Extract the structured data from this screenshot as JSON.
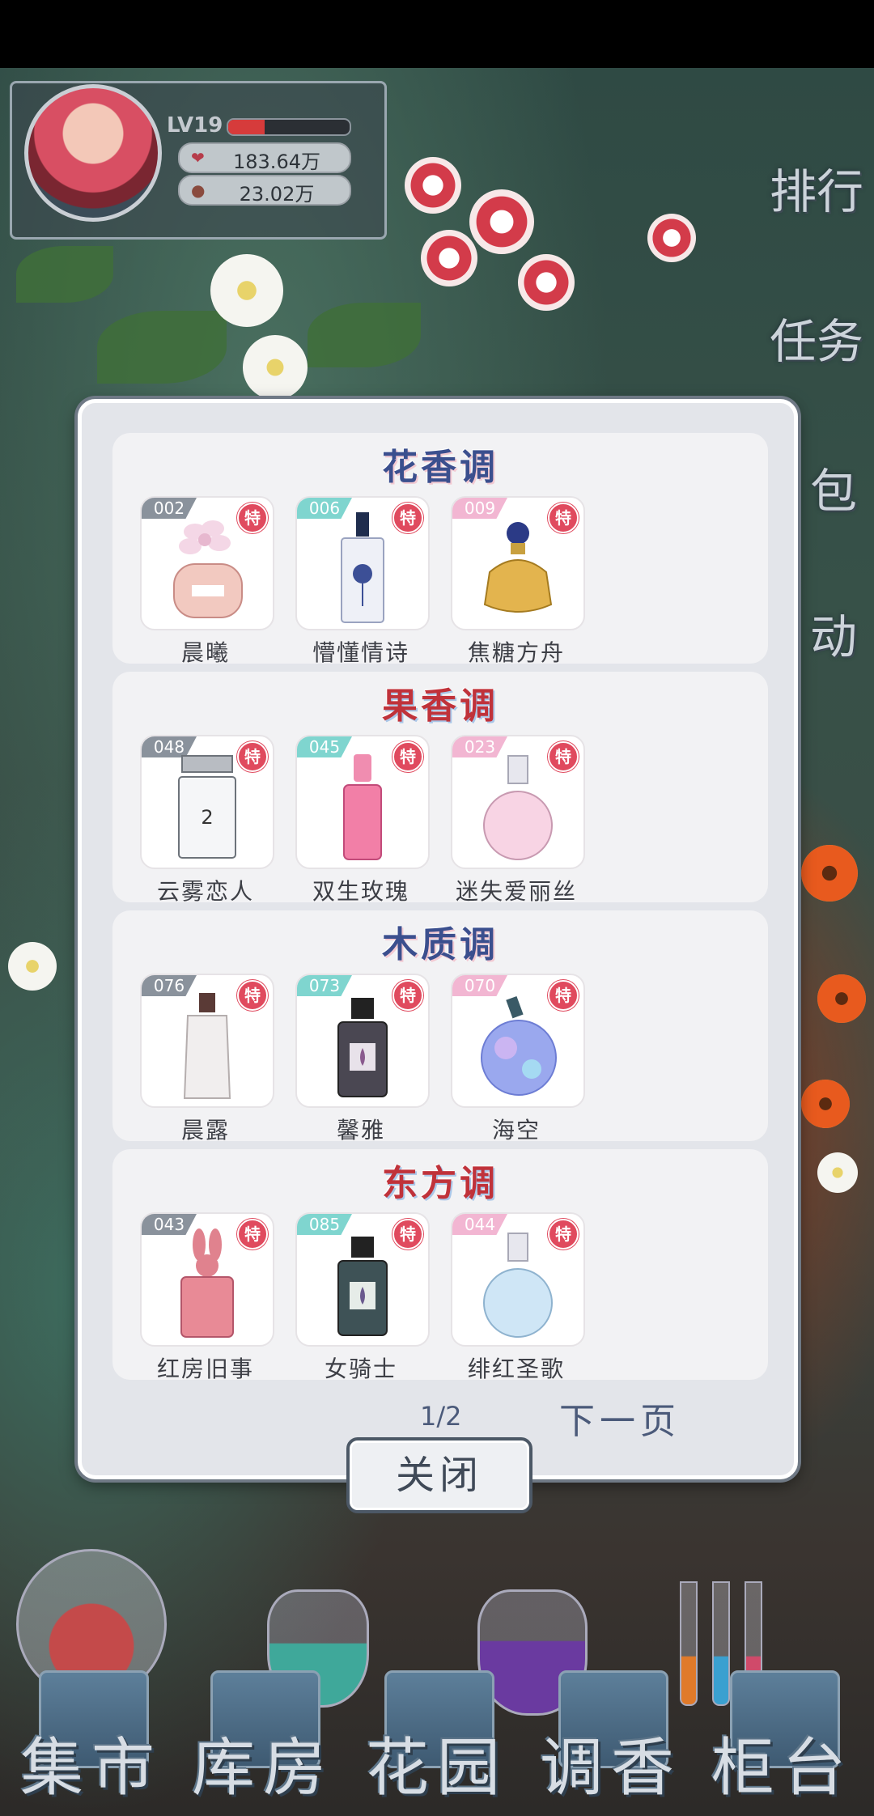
{
  "player": {
    "level_label": "LV19",
    "xp_progress": 0.3,
    "currency1_value": "183.64万",
    "currency2_value": "23.02万"
  },
  "side_menu": {
    "ranking": "排行",
    "tasks": "任务",
    "bag": "包",
    "event": "动"
  },
  "catalog": {
    "sections": [
      {
        "title": "花香调",
        "items": [
          {
            "num": "002",
            "badge": "特",
            "name": "晨曦"
          },
          {
            "num": "006",
            "badge": "特",
            "name": "懵懂情诗"
          },
          {
            "num": "009",
            "badge": "特",
            "name": "焦糖方舟"
          }
        ]
      },
      {
        "title": "果香调",
        "items": [
          {
            "num": "048",
            "badge": "特",
            "name": "云雾恋人",
            "bottle_text": "2"
          },
          {
            "num": "045",
            "badge": "特",
            "name": "双生玫瑰"
          },
          {
            "num": "023",
            "badge": "特",
            "name": "迷失爱丽丝"
          }
        ]
      },
      {
        "title": "木质调",
        "items": [
          {
            "num": "076",
            "badge": "特",
            "name": "晨露"
          },
          {
            "num": "073",
            "badge": "特",
            "name": "馨雅"
          },
          {
            "num": "070",
            "badge": "特",
            "name": "海空"
          }
        ]
      },
      {
        "title": "东方调",
        "items": [
          {
            "num": "043",
            "badge": "特",
            "name": "红房旧事"
          },
          {
            "num": "085",
            "badge": "特",
            "name": "女骑士"
          },
          {
            "num": "044",
            "badge": "特",
            "name": "绯红圣歌"
          }
        ]
      }
    ],
    "page_indicator": "1/2",
    "next_page": "下一页",
    "close": "关闭"
  },
  "bottom_nav": {
    "market": "集市",
    "storage": "库房",
    "garden": "花园",
    "blend": "调香",
    "counter": "柜台"
  },
  "colors": {
    "badge": "#e04a5e",
    "num_gray": "#8a929c",
    "num_teal": "#7fd5cf",
    "num_pink": "#f2b6d2",
    "title_blue": "#3b4f8e",
    "title_red": "#c0323a"
  }
}
